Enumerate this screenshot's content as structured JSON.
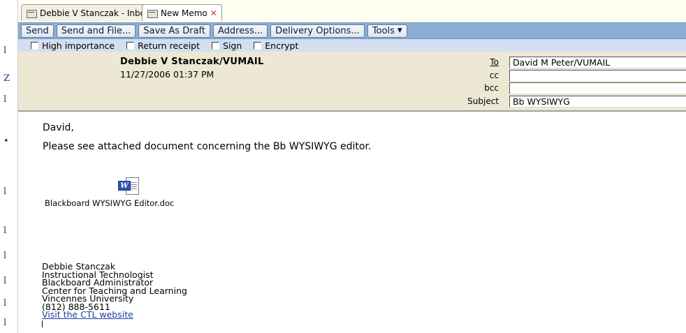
{
  "tabs": [
    {
      "label": "Debbie V Stanczak - Inbox",
      "icon": "inbox-icon",
      "active": false
    },
    {
      "label": "New Memo",
      "icon": "memo-icon",
      "active": true,
      "close": "✕"
    }
  ],
  "toolbar": {
    "send": "Send",
    "send_and_file": "Send and File...",
    "save_as_draft": "Save As Draft",
    "address": "Address...",
    "delivery_options": "Delivery Options...",
    "tools": "Tools"
  },
  "options": {
    "high_importance": "High importance",
    "return_receipt": "Return receipt",
    "sign": "Sign",
    "encrypt": "Encrypt"
  },
  "header": {
    "from_name": "Debbie V Stanczak/VUMAIL",
    "from_date": "11/27/2006 01:37 PM",
    "to_label": "To",
    "to_value": "David M Peter/VUMAIL",
    "cc_label": "cc",
    "cc_value": "",
    "bcc_label": "bcc",
    "bcc_value": "",
    "subject_label": "Subject",
    "subject_value": "Bb WYSIWYG"
  },
  "body": {
    "greeting": "David,",
    "text": "Please see attached document concerning the Bb WYSIWYG editor.",
    "attachment": "Blackboard WYSIWYG Editor.doc",
    "attachment_badge": "W"
  },
  "signature": {
    "name": "Debbie Stanczak",
    "title": "Instructional Technologist",
    "role": "Blackboard Administrator",
    "dept": "Center for Teaching and Learning",
    "org": "Vincennes University",
    "phone": "(812) 888-5611",
    "link": "Visit the CTL website"
  },
  "colors": {
    "toolbar": "#8aaed4",
    "options_bar": "#d4def0",
    "header_bg": "#ece8d3",
    "link": "#1b3f9e",
    "close": "#d23a2b"
  }
}
